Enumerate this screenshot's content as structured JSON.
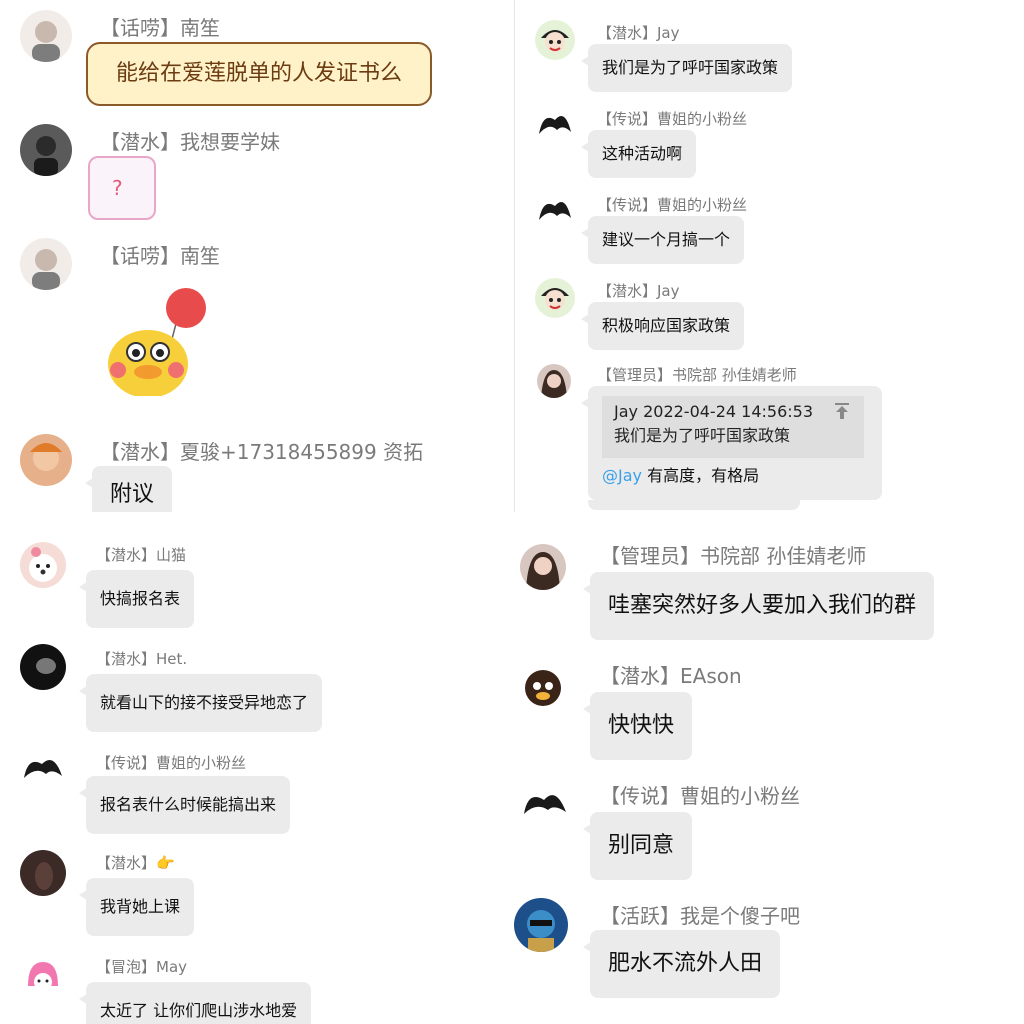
{
  "top_left": {
    "messages": [
      {
        "sender": "【话唠】南笙",
        "text": "能给在爱莲脱单的人发证书么"
      },
      {
        "sender": "【潜水】我想要学妹",
        "sticker_text": "?"
      },
      {
        "sender": "【话唠】南笙"
      },
      {
        "sender": "【潜水】夏骏+17318455899 资拓",
        "text": "附议"
      }
    ]
  },
  "top_right": {
    "messages": [
      {
        "sender": "【潜水】Jay",
        "text": "我们是为了呼吁国家政策"
      },
      {
        "sender": "【传说】曹姐的小粉丝",
        "text": "这种活动啊"
      },
      {
        "sender": "【传说】曹姐的小粉丝",
        "text": "建议一个月搞一个"
      },
      {
        "sender": "【潜水】Jay",
        "text": "积极响应国家政策"
      },
      {
        "sender": "【管理员】书院部 孙佳婧老师",
        "quote_header": "Jay  2022-04-24 14:56:53",
        "quote_text": "我们是为了呼吁国家政策",
        "mention": "@Jay",
        "text": " 有高度，有格局"
      }
    ]
  },
  "bottom_left": {
    "messages": [
      {
        "sender": "【潜水】山猫",
        "text": "快搞报名表"
      },
      {
        "sender": "【潜水】Het.",
        "text": "就看山下的接不接受异地恋了"
      },
      {
        "sender": "【传说】曹姐的小粉丝",
        "text": "报名表什么时候能搞出来"
      },
      {
        "sender": "【潜水】",
        "text": "我背她上课"
      },
      {
        "sender": "【冒泡】May",
        "text": "太近了 让你们爬山涉水地爱"
      }
    ]
  },
  "bottom_right": {
    "messages": [
      {
        "sender": "【管理员】书院部 孙佳婧老师",
        "text": "哇塞突然好多人要加入我们的群"
      },
      {
        "sender": "【潜水】EAson",
        "text": "快快快"
      },
      {
        "sender": "【传说】曹姐的小粉丝",
        "text": "别同意"
      },
      {
        "sender": "【活跃】我是个傻子吧",
        "text": "肥水不流外人田"
      }
    ]
  },
  "colors": {
    "bubble": "#ebebeb",
    "sender": "#7a7a7a",
    "mention": "#3aa0e8"
  }
}
